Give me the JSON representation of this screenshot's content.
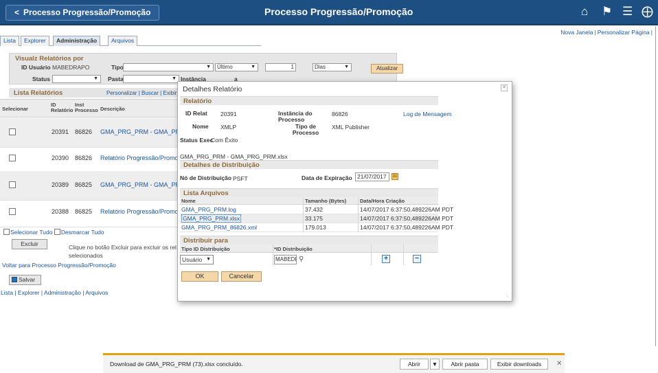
{
  "header": {
    "back_label": "Processo Progressão/Promoção",
    "title": "Processo Progressão/Promoção",
    "icons": [
      "home-icon",
      "flag-icon",
      "menu-icon",
      "compass-icon"
    ]
  },
  "right_links": {
    "new_window": "Nova Janela",
    "personalize": "Personalizar Página"
  },
  "tabs": [
    "Lista",
    "Explorer",
    "Administração",
    "Arquivos"
  ],
  "search": {
    "title": "Visualz Relatórios por",
    "id_usuario_label": "ID Usuário",
    "id_usuario_value": "MABEDRAPO",
    "tipo_label": "Tipo",
    "tipo_value": "",
    "ultimo_value": "Último",
    "count_value": "1",
    "dias_value": "Dias",
    "status_label": "Status",
    "pasta_label": "Pasta",
    "instancia_label": "Instância",
    "a_label": "a",
    "atualizar_label": "Atualizar"
  },
  "reports": {
    "title": "Lista Relatórios",
    "links": "Personalizar | Buscar | Exibir",
    "columns": [
      "Selecionar",
      "ID Relatório",
      "Inst Processo",
      "Descrição"
    ],
    "rows": [
      {
        "id": "20391",
        "inst": "86826",
        "desc": "GMA_PRG_PRM - GMA_PR"
      },
      {
        "id": "20390",
        "inst": "86826",
        "desc": "Relatório Progressão/Promoç"
      },
      {
        "id": "20389",
        "inst": "86825",
        "desc": "GMA_PRG_PRM - GMA_PR"
      },
      {
        "id": "20388",
        "inst": "86825",
        "desc": "Relatório Progressão/Promoç"
      }
    ],
    "select_all": "Selecionar Tudo",
    "deselect_all": "Desmarcar Tudo",
    "excluir_label": "Excluir",
    "excluir_help": "Clique no botão Excluir para excluir os rel selecionados",
    "voltar": "Voltar para Processo Progressão/Promoção",
    "salvar": "Salvar",
    "bottom_links": [
      "Lista",
      "Explorer",
      "Administração",
      "Arquivos"
    ]
  },
  "modal": {
    "title": "Detalhes Relatório",
    "section_relatorio": "Relatório",
    "id_relat_label": "ID Relat",
    "id_relat_value": "20391",
    "instancia_label": "Instância do Processo",
    "instancia_value": "86826",
    "log_link": "Log de Mensagem",
    "nome_label": "Nome",
    "nome_value": "XMLP",
    "tipo_label": "Tipo de Processo",
    "tipo_value": "XML Publisher",
    "status_label": "Status Exec",
    "status_value": "Com Êxito",
    "file_desc": "GMA_PRG_PRM - GMA_PRG_PRM.xlsx",
    "section_distrib": "Detalhes de Distribuição",
    "no_distrib_label": "Nó de Distribuição",
    "no_distrib_value": "PSFT",
    "expiracao_label": "Data de Expiração",
    "expiracao_value": "21/07/2017",
    "section_arquivos": "Lista Arquivos",
    "files_columns": [
      "Nome",
      "Tamanho (Bytes)",
      "Data/Hora Criação"
    ],
    "files": [
      {
        "name": "GMA_PRG_PRM.log",
        "size": "37.432",
        "date": "14/07/2017  6:37:50,489226AM PDT"
      },
      {
        "name": "GMA_PRG_PRM.xlsx",
        "size": "33.175",
        "date": "14/07/2017  6:37:50,489226AM PDT"
      },
      {
        "name": "GMA_PRG_PRM_86826.xml",
        "size": "179.013",
        "date": "14/07/2017  6:37:50,489226AM PDT"
      }
    ],
    "section_distribuir": "Distribuir para",
    "dist_columns": [
      "Tipo ID Distribuição",
      "*ID Distribuição"
    ],
    "dist_tipo_value": "Usuário",
    "dist_id_value": "MABEDRAPO",
    "ok_label": "OK",
    "cancel_label": "Cancelar"
  },
  "download_bar": {
    "message": "Download de GMA_PRG_PRM (73).xlsx concluído.",
    "open_label": "Abrir",
    "open_folder_label": "Abrir pasta",
    "view_downloads_label": "Exibir downloads"
  }
}
